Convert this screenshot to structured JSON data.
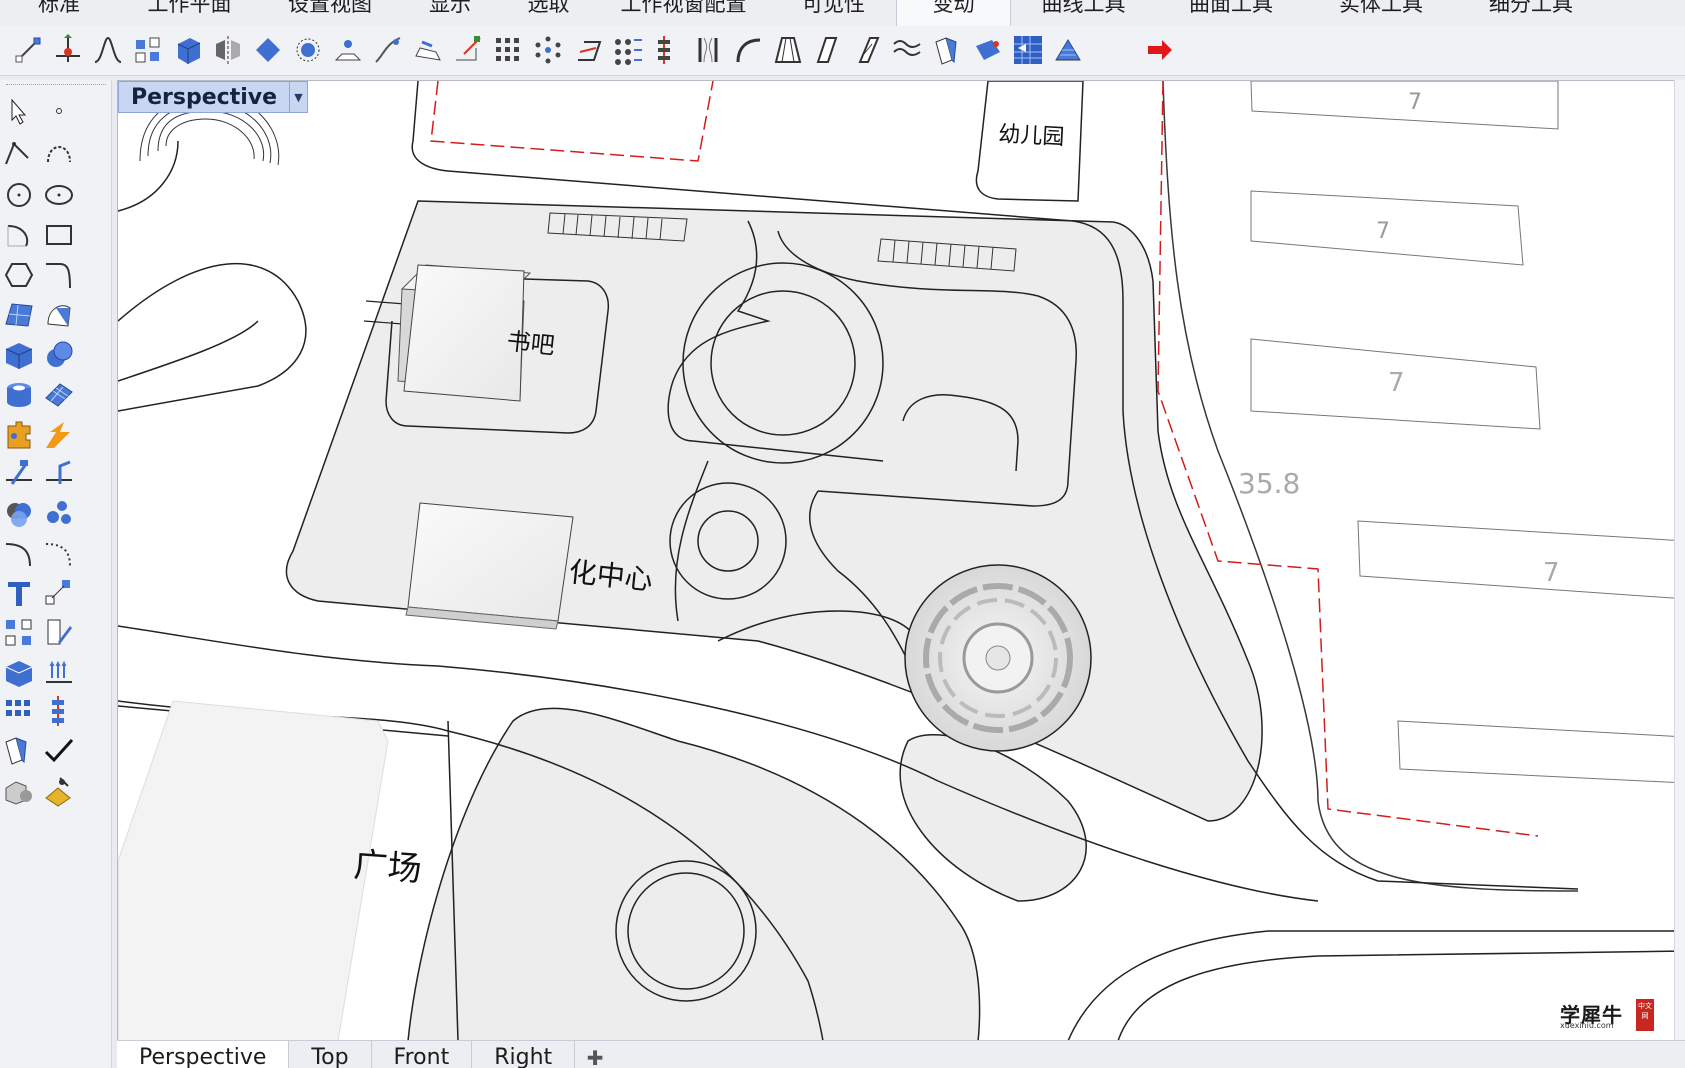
{
  "menu_tabs": [
    "标准",
    "工作平面",
    "设置视图",
    "显示",
    "选取",
    "工作视窗配置",
    "可见性",
    "变动",
    "曲线工具",
    "曲面工具",
    "实体工具",
    "细分工具"
  ],
  "active_menu_tab": "变动",
  "toolbar_icons": [
    "scale-icon",
    "gumball-icon",
    "bend-icon",
    "align-icon",
    "box-edit-icon",
    "mirror-icon",
    "orient-icon",
    "rotate-3d-icon",
    "project-icon",
    "flow-icon",
    "twist-icon",
    "setpt-icon",
    "array-icon",
    "array-polar-icon",
    "shear-icon",
    "array-curve-icon",
    "array-srf-icon",
    "stretch-icon",
    "flow-along-icon",
    "taper-icon",
    "splop-icon",
    "smooth-icon",
    "cage-edit-icon",
    "unroll-icon",
    "squish-icon",
    "stretch-box-icon",
    "flow-srf-icon",
    "red-arrow-icon"
  ],
  "left_toolbar_icons": [
    "select-arrow-icon",
    "point-icon",
    "polyline-icon",
    "curve-icon",
    "circle-icon",
    "ellipse-icon",
    "arc-icon",
    "rectangle-icon",
    "polygon-icon",
    "fillet-curve-icon",
    "surface-from-points-icon",
    "extrude-surface-icon",
    "box-icon",
    "sphere-icon",
    "cylinder-icon",
    "mesh-plane-icon",
    "puzzle-icon",
    "explode-icon",
    "split-icon",
    "trim-icon",
    "boolean-union-icon",
    "boolean-split-icon",
    "curve-from-object-icon",
    "dashed-curve-icon",
    "text-icon",
    "transform-scale-icon",
    "group-icon",
    "edit-pen-icon",
    "box-blue-icon",
    "ruler-icon",
    "array-grid-icon",
    "stack-icon",
    "layer-icon",
    "check-icon",
    "render-icon",
    "material-icon"
  ],
  "viewport": {
    "title": "Perspective",
    "labels": {
      "kindergarten": "幼儿园",
      "bar": "书吧",
      "center": "化中心",
      "square": "广场",
      "num_a": "7",
      "num_b": "7",
      "num_c": "7",
      "num_d": "7",
      "elevation": "35.8"
    }
  },
  "view_tabs": [
    "Perspective",
    "Top",
    "Front",
    "Right"
  ],
  "active_view_tab": "Perspective",
  "watermark": {
    "name": "学犀牛",
    "url": "xuexiniu.com",
    "seal": "中文网"
  },
  "colors": {
    "accent_red": "#d21d1d",
    "viewport_title_bg": "#c9d6f2",
    "plaza_fill": "#ededed"
  }
}
